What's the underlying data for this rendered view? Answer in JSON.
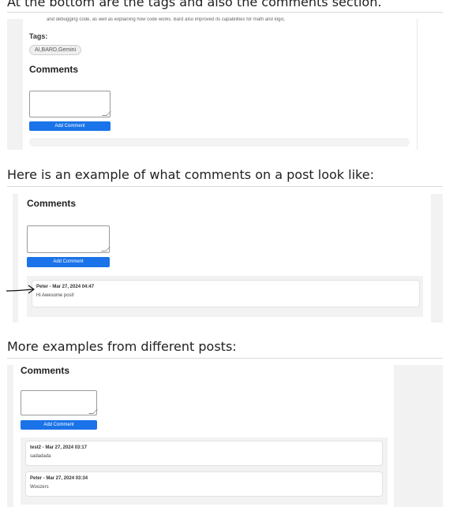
{
  "section1": {
    "heading": "At the bottom are the tags and also the comments section.",
    "truncated_text": "and debugging code, as well as explaining how code works. Bard also improved its capabilities for math and logic.",
    "tags_label": "Tags:",
    "tags": [
      "AI,BARD,Gemini"
    ],
    "comments_title": "Comments",
    "add_comment_label": "Add Comment"
  },
  "section2": {
    "heading": "Here is an example of what comments on a post look like:",
    "comments_title": "Comments",
    "add_comment_label": "Add Comment",
    "comments": [
      {
        "header": "Peter - Mar 27, 2024 04:47",
        "body": "Hi Awesome post!"
      }
    ]
  },
  "section3": {
    "heading": "More examples from different posts:",
    "comments_title": "Comments",
    "add_comment_label": "Add Comment",
    "comments": [
      {
        "header": "test2 - Mar 27, 2024 03:17",
        "body": "sadadada"
      },
      {
        "header": "Peter - Mar 27, 2024 03:34",
        "body": "Woozers"
      }
    ]
  }
}
